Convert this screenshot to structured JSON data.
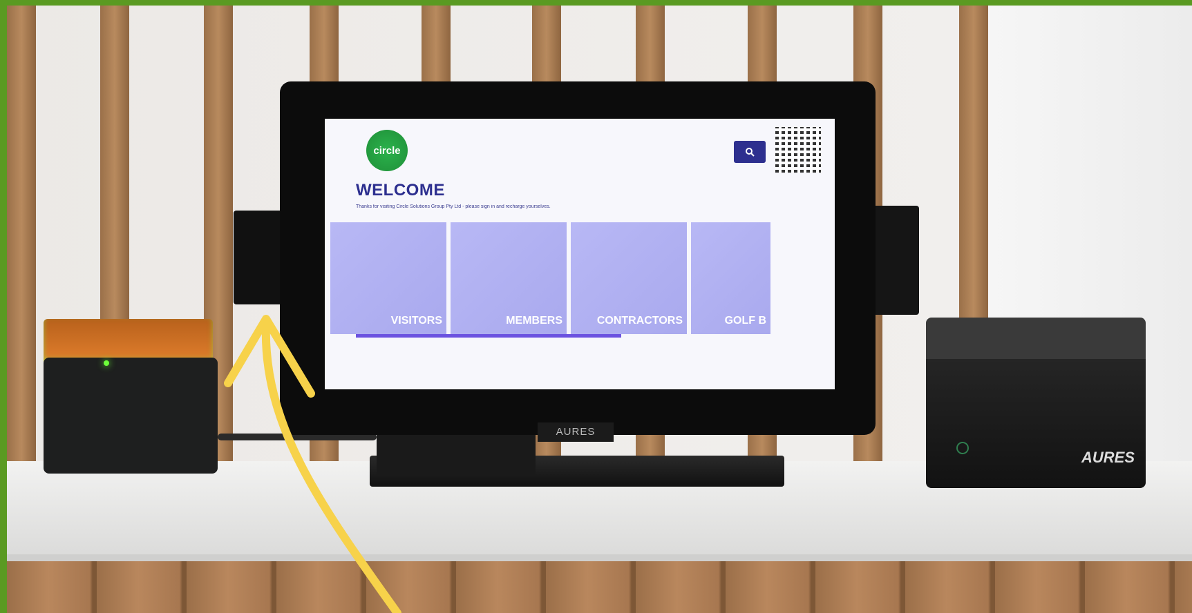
{
  "screen": {
    "logo_text": "circle",
    "title": "WELCOME",
    "subtitle": "Thanks for visiting Circle Solutions Group Pty Ltd - please sign in and recharge yourselves.",
    "tiles": [
      "VISITORS",
      "MEMBERS",
      "CONTRACTORS",
      "GOLF B"
    ],
    "search_icon": "search-icon",
    "progress_fraction": 0.52
  },
  "devices": {
    "monitor_brand": "AURES",
    "printer_brand": "AURES"
  },
  "colors": {
    "frame": "#5a9a22",
    "brand_blue": "#2d2f8f",
    "tile_purple": "#b0b0f2",
    "progress": "#6b52e0",
    "arrow": "#f7d24a"
  }
}
